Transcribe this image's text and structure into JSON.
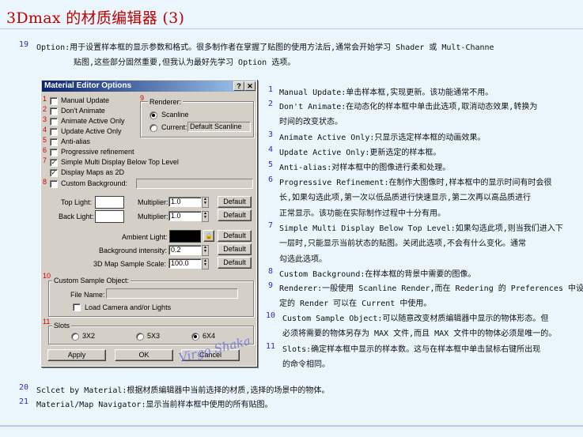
{
  "page": {
    "title": "3Dmax 的材质编辑器 (3)"
  },
  "intro": {
    "num": "19",
    "line1": "Option:用于设置样本框的显示参数和格式。很多制作者在掌握了贴图的使用方法后,通常会开始学习 Shader 或 Mult-Channe",
    "line2": "贴图,这些部分固然重要,但我认为最好先学习 Option 选项。"
  },
  "dialog": {
    "title": "Material Editor Options",
    "help_btn": "?",
    "close_btn": "✕",
    "checks": [
      {
        "num": "1",
        "label": "Manual Update",
        "checked": false
      },
      {
        "num": "2",
        "label": "Don't Animate",
        "checked": false
      },
      {
        "num": "3",
        "label": "Animate Active Only",
        "checked": false
      },
      {
        "num": "4",
        "label": "Update Active Only",
        "checked": false
      },
      {
        "num": "5",
        "label": "Anti-alias",
        "checked": false
      },
      {
        "num": "6",
        "label": "Progressive refinement",
        "checked": false
      },
      {
        "num": "7",
        "label": "Simple Multi Display Below Top Level",
        "checked": true
      },
      {
        "num": "",
        "label": "Display Maps as 2D",
        "checked": true
      },
      {
        "num": "8",
        "label": "Custom Background:",
        "checked": false
      }
    ],
    "renderer": {
      "num": "9",
      "label": "Renderer:",
      "scanline": "Scanline",
      "current": "Current:",
      "current_value": "Default Scanline"
    },
    "top_light": "Top Light:",
    "back_light": "Back Light:",
    "multiplier": "Multiplier:",
    "top_mult": "1.0",
    "back_mult": "1.0",
    "default": "Default",
    "ambient": "Ambient Light:",
    "bg_intensity": "Background intensity:",
    "bg_value": "0.2",
    "map_scale": "3D Map Sample Scale:",
    "map_value": "100.0",
    "custom_obj": {
      "num": "10",
      "label": "Custom Sample Object:",
      "file_name": "File Name:",
      "load_camera": "Load Camera and/or Lights"
    },
    "slots": {
      "num": "11",
      "label": "Slots",
      "options": [
        "3X2",
        "5X3",
        "6X4"
      ],
      "selected": 2
    },
    "apply": "Apply",
    "ok": "OK",
    "cancel": "Cancel",
    "signature": "Virgo Shaka"
  },
  "items": [
    {
      "num": "1",
      "lines": [
        "Manual Update:单击样本框,实现更新。该功能通常不用。"
      ]
    },
    {
      "num": "2",
      "lines": [
        "Don't Animate:在动态化的样本框中单击此选项,取消动态效果,转换为",
        "时间的改变状态。"
      ]
    },
    {
      "num": "3",
      "lines": [
        "Animate Active Only:只显示选定样本框的动画效果。"
      ]
    },
    {
      "num": "4",
      "lines": [
        "Update Active Only:更新选定的样本框。"
      ]
    },
    {
      "num": "5",
      "lines": [
        "Anti-alias:对样本框中的图像进行柔和处理。"
      ]
    },
    {
      "num": "6",
      "lines": [
        "Progressive Refinement:在制作大图像时,样本框中的显示时间有时会很",
        "长,如果勾选此项,第一次以低品质进行快速显示,第二次再以高品质进行",
        "正常显示。该功能在实际制作过程中十分有用。"
      ]
    },
    {
      "num": "7",
      "lines": [
        "Simple Multi Display Below Top Level:如果勾选此项,则当我们进入下",
        "一层时,只能显示当前状态的贴图。关闭此选项,不会有什么变化。通常",
        "勾选此选项。"
      ]
    },
    {
      "num": "8",
      "lines": [
        "Custom Background:在样本框的背景中需要的图像。"
      ]
    },
    {
      "num": "9",
      "lines": [
        "Renderer:一般使用 Scanline Render,而在 Redering 的 Preferences 中设",
        "定的 Render 可以在 Current 中使用。"
      ]
    },
    {
      "num": "10",
      "lines": [
        "Custom Sample Object:可以随意改变材质编辑器中显示的物体形态。但",
        "必须将需要的物体另存为 MAX 文件,而且 MAX 文件中的物体必须是唯一的。"
      ]
    },
    {
      "num": "11",
      "lines": [
        "Slots:确定样本框中显示的样本数。这与在样本框中单击鼠标右键所出现",
        "的命令相同。"
      ]
    }
  ],
  "footer": [
    {
      "num": "20",
      "text": "Sclcet by Material:根据材质编辑器中当前选择的材质,选择的场景中的物体。"
    },
    {
      "num": "21",
      "text": "Material/Map Navigator:显示当前样本框中使用的所有贴图。"
    }
  ]
}
